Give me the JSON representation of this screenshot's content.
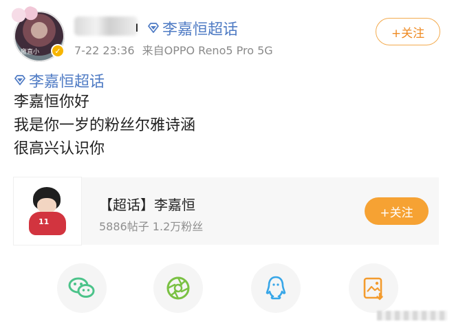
{
  "post": {
    "author_suffix": "ı",
    "topic_label": "李嘉恒超话",
    "time": "7-22 23:36",
    "source": "来自OPPO Reno5 Pro 5G",
    "follow_label": "+关注",
    "avatar_text": "雍直小"
  },
  "body": {
    "topic_label": "李嘉恒超话",
    "lines": [
      "李嘉恒你好",
      "我是你一岁的粉丝尔雅诗涵",
      "很高兴认识你"
    ]
  },
  "card": {
    "title": "【超话】李嘉恒",
    "stats": "5886帖子 1.2万粉丝",
    "follow_label": "+关注",
    "jersey_number": "11"
  },
  "share": {
    "icons": [
      "wechat-icon",
      "moments-icon",
      "qq-icon",
      "save-image-icon"
    ]
  },
  "colors": {
    "link": "#4f7bc4",
    "accent": "#f6a233",
    "verified": "#f7b500"
  }
}
